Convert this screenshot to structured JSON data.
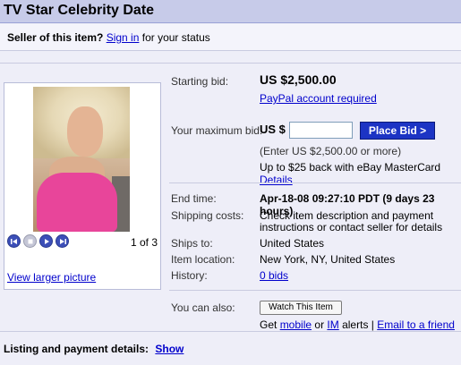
{
  "title": "TV Star Celebrity Date",
  "seller_bar": {
    "question": "Seller of this item?",
    "signin": "Sign in",
    "suffix": "for your status"
  },
  "bid": {
    "starting_label": "Starting bid:",
    "starting_value": "US $2,500.00",
    "paypal_link": "PayPal account required",
    "max_label": "Your maximum bid:",
    "currency": "US $",
    "input_value": "",
    "button": "Place Bid >",
    "hint": "(Enter US $2,500.00 or more)",
    "mastercard_text": "Up to $25 back with eBay MasterCard",
    "details_link": "Details"
  },
  "info": {
    "end_label": "End time:",
    "end_value": "Apr-18-08 09:27:10 PDT (9 days 23 hours)",
    "shipping_label": "Shipping costs:",
    "shipping_value_1": "Check item description and payment",
    "shipping_value_2": "instructions or contact seller for details",
    "ships_label": "Ships to:",
    "ships_value": "United States",
    "location_label": "Item location:",
    "location_value": "New York, NY, United States",
    "history_label": "History:",
    "history_link": "0 bids"
  },
  "also": {
    "label": "You can also:",
    "watch_button": "Watch This Item",
    "get": "Get",
    "mobile_link": "mobile",
    "or": "or",
    "im_link": "IM",
    "alerts": "alerts |",
    "email_link": "Email to a friend"
  },
  "photo": {
    "counter": "1 of 3",
    "larger_link": "View larger picture"
  },
  "bottom": {
    "label": "Listing and payment details:",
    "show_link": "Show"
  },
  "colors": {
    "title_bg": "#c7cbe9",
    "button_blue": "#1c34c4",
    "link": "#0000cc"
  }
}
